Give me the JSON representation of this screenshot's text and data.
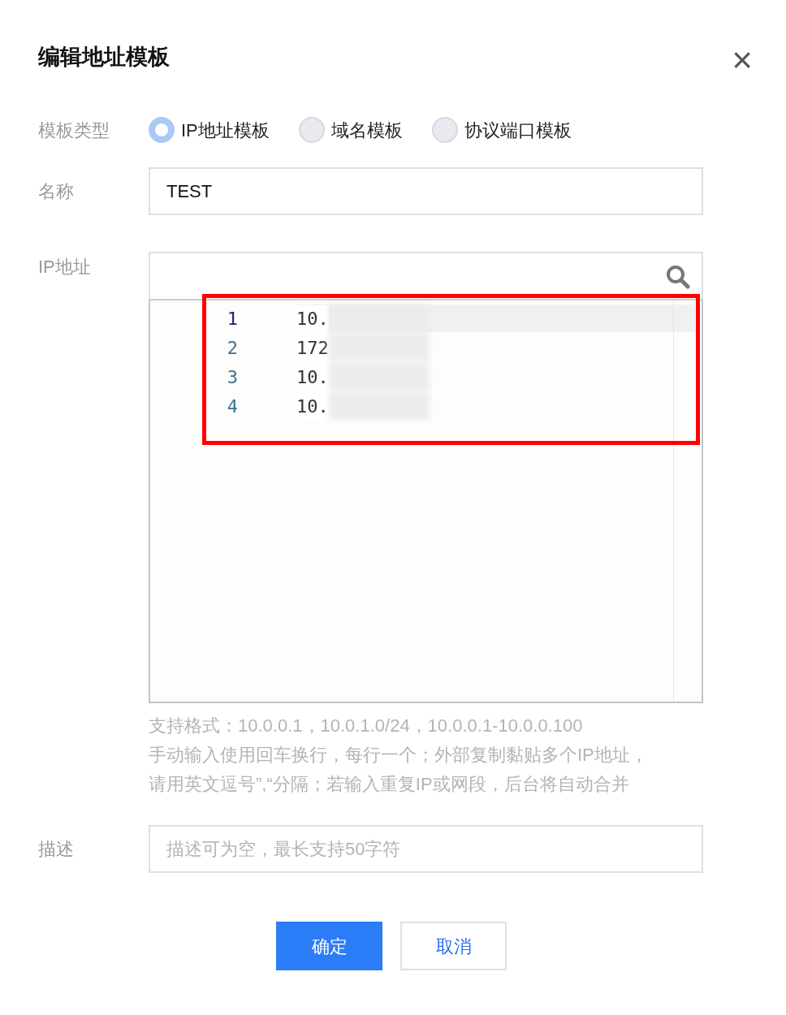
{
  "dialog": {
    "title": "编辑地址模板",
    "close": "×"
  },
  "template_type": {
    "label": "模板类型",
    "options": [
      {
        "label": "IP地址模板",
        "selected": true
      },
      {
        "label": "域名模板",
        "selected": false
      },
      {
        "label": "协议端口模板",
        "selected": false
      }
    ]
  },
  "name": {
    "label": "名称",
    "value": "TEST"
  },
  "ip_addresses": {
    "label": "IP地址",
    "lines": [
      {
        "number": "1",
        "text": "10.",
        "active": true
      },
      {
        "number": "2",
        "text": "172",
        "active": false
      },
      {
        "number": "3",
        "text": "10.",
        "active": false
      },
      {
        "number": "4",
        "text": "10.",
        "active": false
      }
    ],
    "help": [
      "支持格式：10.0.0.1，10.0.1.0/24，10.0.0.1-10.0.0.100",
      "手动输入使用回车换行，每行一个；外部复制黏贴多个IP地址，",
      "请用英文逗号”,“分隔；若输入重复IP或网段，后台将自动合并"
    ]
  },
  "description": {
    "label": "描述",
    "placeholder": "描述可为空，最长支持50字符"
  },
  "buttons": [
    {
      "label": "确定",
      "kind": "primary"
    },
    {
      "label": "取消",
      "kind": "secondary"
    }
  ]
}
